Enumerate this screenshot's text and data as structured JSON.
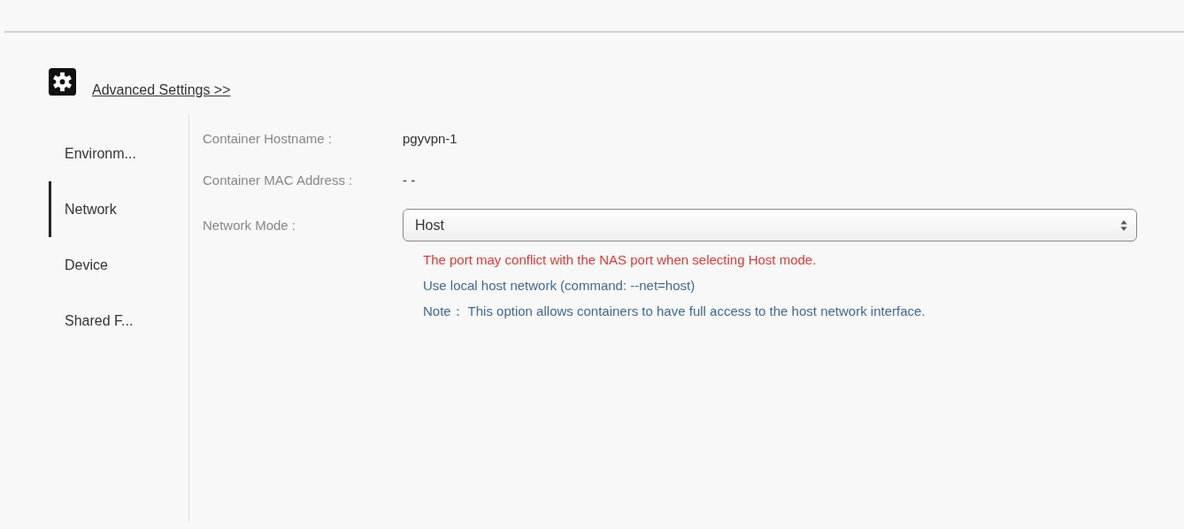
{
  "header": {
    "link": "Advanced Settings >>"
  },
  "sidebar": {
    "items": [
      {
        "label": "Environm...",
        "selected": false
      },
      {
        "label": "Network",
        "selected": true
      },
      {
        "label": "Device",
        "selected": false
      },
      {
        "label": "Shared F...",
        "selected": false
      }
    ]
  },
  "form": {
    "fields": [
      {
        "kind": "text",
        "label": "Container Hostname :",
        "value": "pgyvpn-1"
      },
      {
        "kind": "text",
        "label": "Container MAC Address :",
        "value": "- -"
      },
      {
        "kind": "select",
        "label": "Network Mode :",
        "value": "Host"
      }
    ],
    "notes": [
      {
        "kind": "warning",
        "text": "The port may conflict with the NAS port when selecting Host mode."
      },
      {
        "kind": "info",
        "text": "Use local host network (command: --net=host)"
      },
      {
        "kind": "info",
        "text": "Note：  This option allows containers to have full access to the host network interface."
      }
    ]
  }
}
